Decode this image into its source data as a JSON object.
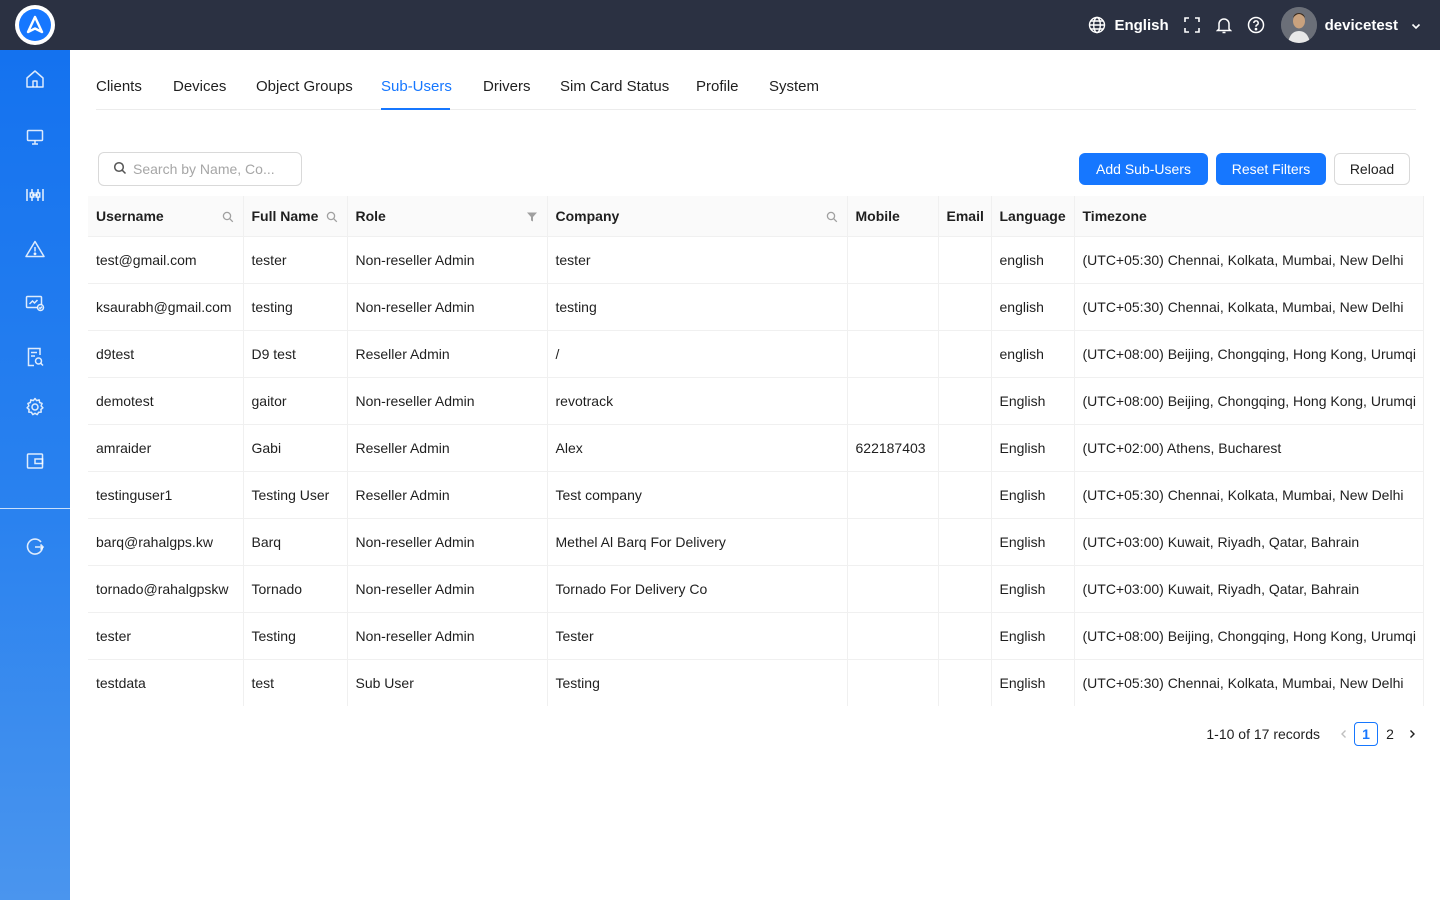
{
  "header": {
    "language_label": "English",
    "user_name": "devicetest"
  },
  "tabs": [
    {
      "label": "Clients"
    },
    {
      "label": "Devices"
    },
    {
      "label": "Object Groups"
    },
    {
      "label": "Sub-Users"
    },
    {
      "label": "Drivers"
    },
    {
      "label": "Sim Card Status"
    },
    {
      "label": "Profile"
    },
    {
      "label": "System"
    }
  ],
  "active_tab": "Sub-Users",
  "toolbar": {
    "search_placeholder": "Search by Name, Co...",
    "add_label": "Add Sub-Users",
    "reset_label": "Reset Filters",
    "reload_label": "Reload"
  },
  "table": {
    "columns": [
      "Username",
      "Full Name",
      "Role",
      "Company",
      "Mobile",
      "Email",
      "Language",
      "Timezone"
    ],
    "rows": [
      [
        "test@gmail.com",
        "tester",
        "Non-reseller Admin",
        "tester",
        "",
        "",
        "english",
        "(UTC+05:30) Chennai, Kolkata, Mumbai, New Delhi"
      ],
      [
        "ksaurabh@gmail.com",
        "testing",
        "Non-reseller Admin",
        "testing",
        "",
        "",
        "english",
        "(UTC+05:30) Chennai, Kolkata, Mumbai, New Delhi"
      ],
      [
        "d9test",
        "D9 test",
        "Reseller Admin",
        "/",
        "",
        "",
        "english",
        "(UTC+08:00) Beijing, Chongqing, Hong Kong, Urumqi"
      ],
      [
        "demotest",
        "gaitor",
        "Non-reseller Admin",
        "revotrack",
        "",
        "",
        "English",
        "(UTC+08:00) Beijing, Chongqing, Hong Kong, Urumqi"
      ],
      [
        "amraider",
        "Gabi",
        "Reseller Admin",
        "Alex",
        "622187403",
        "",
        "English",
        "(UTC+02:00) Athens, Bucharest"
      ],
      [
        "testinguser1",
        "Testing User",
        "Reseller Admin",
        "Test company",
        "",
        "",
        "English",
        "(UTC+05:30) Chennai, Kolkata, Mumbai, New Delhi"
      ],
      [
        "barq@rahalgps.kw",
        "Barq",
        "Non-reseller Admin",
        "Methel Al Barq For Delivery",
        "",
        "",
        "English",
        "(UTC+03:00) Kuwait, Riyadh, Qatar, Bahrain"
      ],
      [
        "tornado@rahalgpskw",
        "Tornado",
        "Non-reseller Admin",
        "Tornado For Delivery Co",
        "",
        "",
        "English",
        "(UTC+03:00) Kuwait, Riyadh, Qatar, Bahrain"
      ],
      [
        "tester",
        "Testing",
        "Non-reseller Admin",
        "Tester",
        "",
        "",
        "English",
        "(UTC+08:00) Beijing, Chongqing, Hong Kong, Urumqi"
      ],
      [
        "testdata",
        "test",
        "Sub User",
        "Testing",
        "",
        "",
        "English",
        "(UTC+05:30) Chennai, Kolkata, Mumbai, New Delhi"
      ]
    ]
  },
  "pagination": {
    "total_text": "1-10 of 17 records",
    "pages": [
      "1",
      "2"
    ],
    "current_page": "1"
  },
  "colors": {
    "topbar": "#2b3142",
    "accent": "#1677ff",
    "sidebar_top": "#1472ef",
    "sidebar_bottom": "#4a95ee"
  },
  "icons": {
    "sidebar": [
      "home-icon",
      "monitor-icon",
      "sliders-icon",
      "warning-icon",
      "dashboard-screen-icon",
      "report-search-icon",
      "settings-gear-icon",
      "wallet-icon",
      "logout-icon"
    ]
  }
}
